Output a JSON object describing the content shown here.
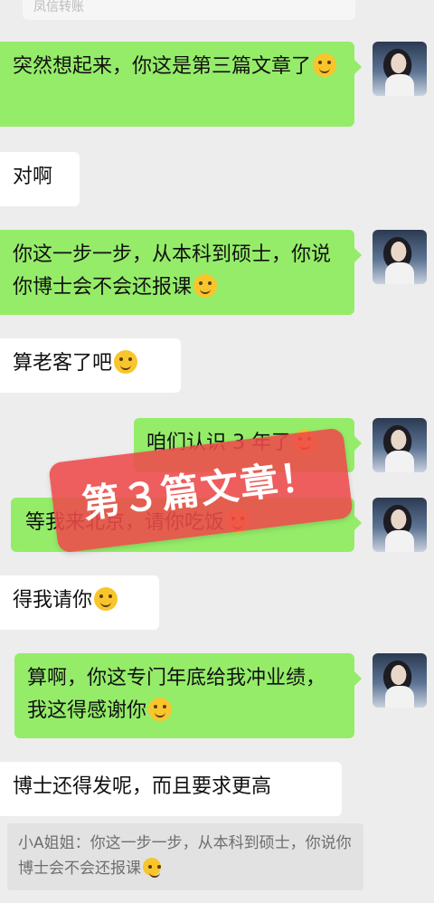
{
  "top_partial": {
    "text": "凤信转账"
  },
  "messages": [
    {
      "side": "right",
      "text": "突然想起来，你这是第三篇文章了",
      "emoji": "laughing-crying-emoji"
    },
    {
      "side": "left",
      "text": "对啊"
    },
    {
      "side": "right",
      "text": "你这一步一步，从本科到硕士，你说你博士会不会还报课",
      "emoji": "thinking-emoji"
    },
    {
      "side": "left",
      "text": "算老客了吧",
      "emoji": "smiling-emoji"
    },
    {
      "side": "right",
      "text": "咱们认识 3 年了",
      "emoji": "smiling-emoji"
    },
    {
      "side": "right",
      "text": "等我来北京，请你吃饭",
      "emoji": "grinning-emoji"
    },
    {
      "side": "left",
      "text": "得我请你",
      "emoji": "hand-over-mouth-emoji"
    },
    {
      "side": "right",
      "text": "算啊，你这专门年底给我冲业绩，我这得感谢你",
      "emoji": "thinking-emoji"
    },
    {
      "side": "left",
      "text": "博士还得发呢，而且要求更高"
    }
  ],
  "quote": {
    "text": "小A姐姐：你这一步一步，从本科到硕士，你说你博士会不会还报课",
    "emoji": "thinking-emoji"
  },
  "stamp": {
    "text": "第３篇文章！"
  },
  "colors": {
    "sent_bubble": "#95ec69",
    "received_bubble": "#ffffff",
    "background": "#ededed",
    "stamp": "#ee4a4a"
  }
}
